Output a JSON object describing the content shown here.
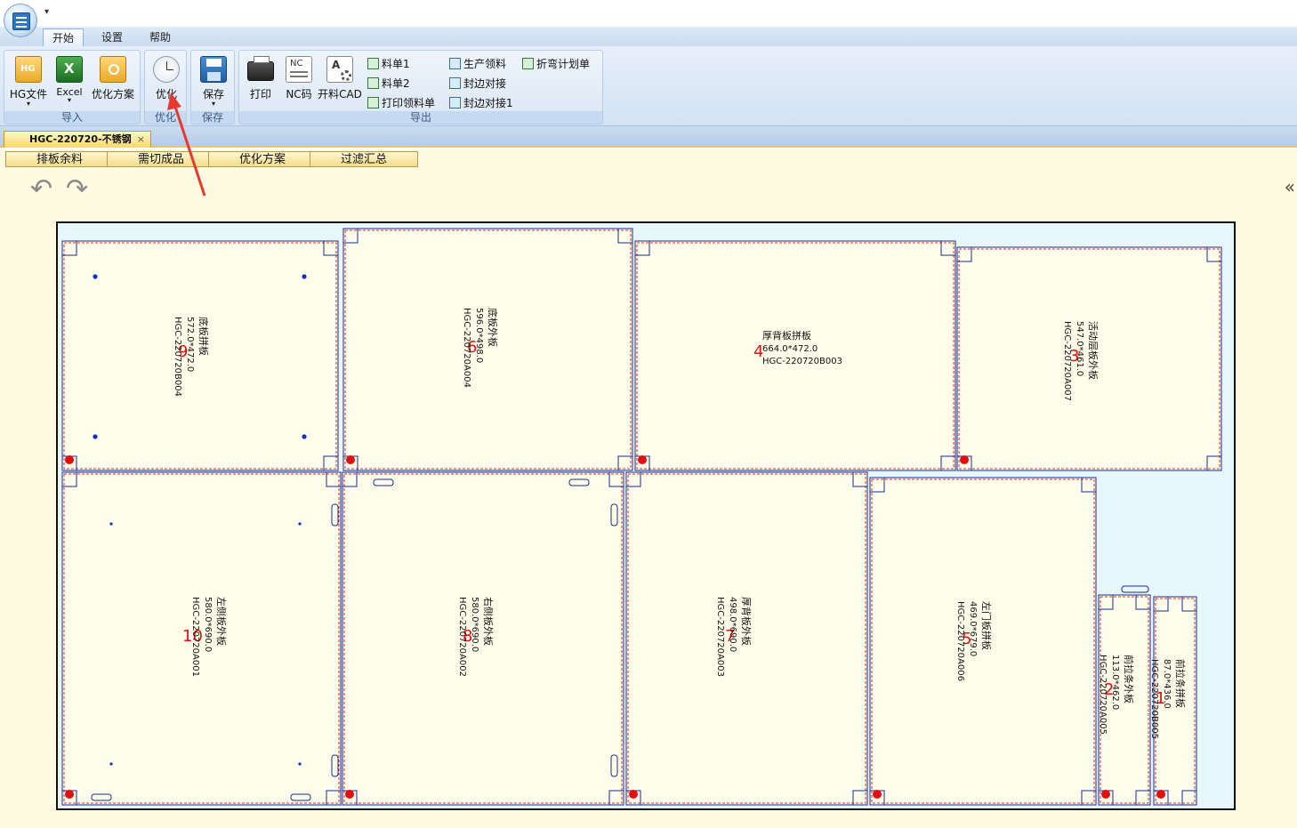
{
  "window": {
    "qat_symbol": "▾"
  },
  "ribbon_tabs": [
    {
      "label": "开始",
      "active": true
    },
    {
      "label": "设置",
      "active": false
    },
    {
      "label": "帮助",
      "active": false
    }
  ],
  "ribbon": {
    "import": {
      "label": "导入",
      "hg": "HG文件",
      "excel": "Excel",
      "plan": "优化方案",
      "hg_badge": "HG",
      "excel_badge": "X"
    },
    "optimize": {
      "label": "优化",
      "button": "优化"
    },
    "save": {
      "label": "保存",
      "button": "保存"
    },
    "export": {
      "label": "导出",
      "print": "打印",
      "nc": "NC码",
      "nc_badge": "NC",
      "cad": "开料CAD",
      "cad_badge": "A",
      "bom1": "料单1",
      "bom2": "料单2",
      "print_bom": "打印领料单",
      "production": "生产领料",
      "edge": "封边对接",
      "edge1": "封边对接1",
      "bend": "折弯计划单"
    }
  },
  "document_tab": {
    "title": "HGC-220720-不锈钢",
    "close": "×"
  },
  "sub_tabs": [
    "排板余料",
    "需切成品",
    "优化方案",
    "过滤汇总"
  ],
  "toolbar": {
    "undo": "↶",
    "redo": "↷",
    "collapse": "«"
  },
  "colors": {
    "part_fill": "#fdfdea",
    "cut_line": "#e03030",
    "outline": "#1a2a8a",
    "marker": "#e01010",
    "background": "#fffbe0"
  },
  "parts": [
    {
      "num": "9",
      "name": "底板拼板",
      "size": "572.0*472.0",
      "code": "HGC-220720B004"
    },
    {
      "num": "6",
      "name": "底板外板",
      "size": "596.0*498.0",
      "code": "HGC-220720A004"
    },
    {
      "num": "4",
      "name": "厚背板拼板",
      "size": "664.0*472.0",
      "code": "HGC-220720B003"
    },
    {
      "num": "3",
      "name": "活动层板外板",
      "size": "547.0*461.0",
      "code": "HGC-220720A007"
    },
    {
      "num": "10",
      "name": "左侧板外板",
      "size": "580.0*690.0",
      "code": "HGC-220720A001"
    },
    {
      "num": "8",
      "name": "右侧板外板",
      "size": "580.0*690.0",
      "code": "HGC-220720A002"
    },
    {
      "num": "7",
      "name": "厚背板外板",
      "size": "498.0*690.0",
      "code": "HGC-220720A003"
    },
    {
      "num": "5",
      "name": "左门板拼板",
      "size": "469.0*679.0",
      "code": "HGC-220720A006"
    },
    {
      "num": "2",
      "name": "前拉条外板",
      "size": "113.0*462.0",
      "code": "HGC-220720A005"
    },
    {
      "num": "1",
      "name": "前拉条拼板",
      "size": "87.0*436.0",
      "code": "HGC-220720B005"
    }
  ]
}
